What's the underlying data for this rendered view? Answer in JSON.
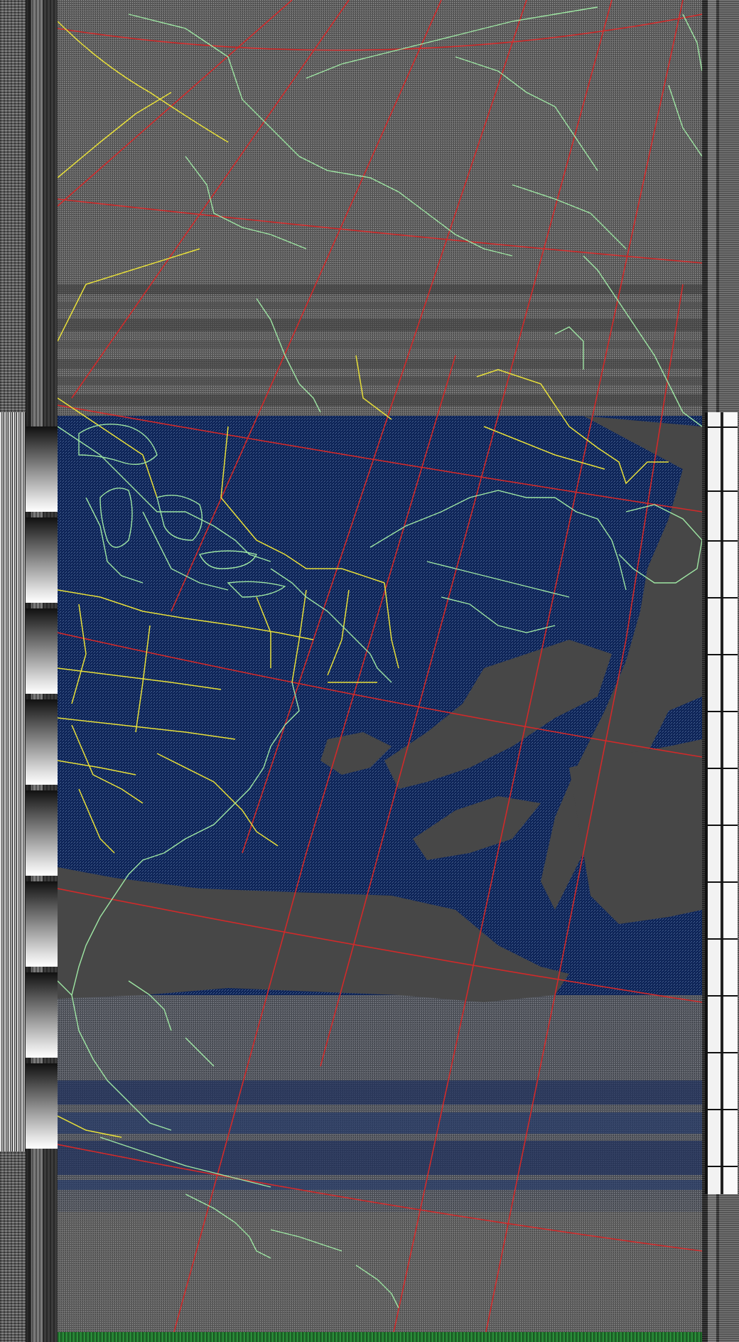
{
  "image": {
    "kind": "weather-satellite-apt-image",
    "subject": "north-atlantic-and-eastern-north-america",
    "colors": {
      "ocean": "#0e2456",
      "cloud": "#474747",
      "land": "#6c6c6c",
      "coastline": "#9ee6a3",
      "borders": "#e8e03a",
      "graticule": "#d12a2a",
      "sync_band": "#2b8f3a"
    }
  }
}
